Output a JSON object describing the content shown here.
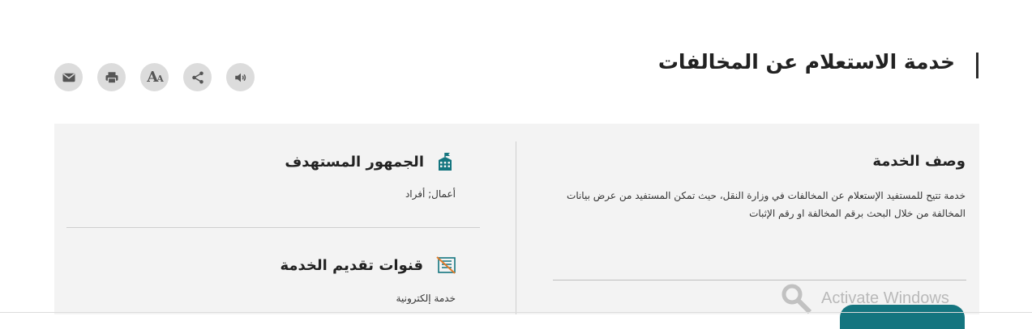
{
  "header": {
    "title": "خدمة الاستعلام عن المخالفات"
  },
  "toolbar": {
    "buttons": [
      {
        "name": "email",
        "icon": "envelope-icon"
      },
      {
        "name": "print",
        "icon": "printer-icon"
      },
      {
        "name": "font-size",
        "icon": "font-size-icon",
        "label": "AA"
      },
      {
        "name": "share",
        "icon": "share-icon"
      },
      {
        "name": "listen",
        "icon": "speaker-icon"
      }
    ]
  },
  "description": {
    "title": "وصف الخدمة",
    "text": "خدمة تتيح للمستفيد الإستعلام عن  المخالفات في وزارة النقل، حيث تمكن المستفيد من عرض بيانات المخالفة من خلال البحث برقم المخالفة او رقم الإثبات"
  },
  "audience": {
    "title": "الجمهور المستهدف",
    "value": "أعمال; أفراد"
  },
  "channels": {
    "title": "قنوات تقديم الخدمة",
    "value": "خدمة إلكترونية"
  },
  "watermark": {
    "text": "Activate Windows"
  },
  "colors": {
    "accent": "#14757f",
    "panel": "#f3f3f3",
    "button": "#dcdcdc"
  }
}
